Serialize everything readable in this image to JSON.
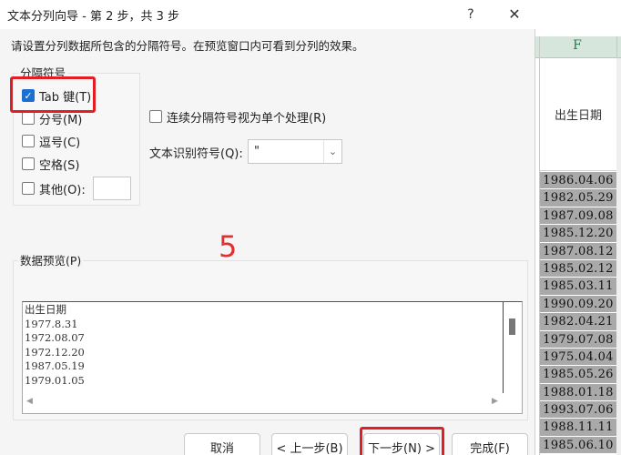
{
  "dialog": {
    "title": "文本分列向导 - 第 2 步，共 3 步",
    "help_label": "?",
    "close_label": "✕",
    "intro": "请设置分列数据所包含的分隔符号。在预览窗口内可看到分列的效果。"
  },
  "delimiters": {
    "group_label": "分隔符号",
    "items": [
      {
        "label": "Tab 键(T)",
        "checked": true
      },
      {
        "label": "分号(M)",
        "checked": false
      },
      {
        "label": "逗号(C)",
        "checked": false
      },
      {
        "label": "空格(S)",
        "checked": false
      },
      {
        "label": "其他(O):",
        "checked": false
      }
    ],
    "other_value": ""
  },
  "options": {
    "consecutive_label": "连续分隔符号视为单个处理(R)",
    "consecutive_checked": false,
    "qualifier_label": "文本识别符号(Q):",
    "qualifier_value": "\""
  },
  "annotation": {
    "step_number": "5",
    "color": "#e21d24"
  },
  "preview": {
    "label": "数据预览(P)",
    "lines": [
      "出生日期",
      "1977.8.31",
      "1972.08.07",
      "1972.12.20",
      "1987.05.19",
      "1979.01.05"
    ]
  },
  "buttons": {
    "cancel": "取消",
    "back": "< 上一步(B)",
    "next": "下一步(N) >",
    "finish": "完成(F)"
  },
  "spreadsheet": {
    "column_letter": "F",
    "header": "出生日期",
    "cells": [
      "1986.04.06",
      "1982.05.29",
      "1987.09.08",
      "1985.12.20",
      "1987.08.12",
      "1985.02.12",
      "1985.03.11",
      "1990.09.20",
      "1982.04.21",
      "1979.07.08",
      "1975.04.04",
      "1985.05.26",
      "1988.01.18",
      "1993.07.06",
      "1988.11.11",
      "1985.06.10"
    ]
  },
  "colors": {
    "checkbox_accent": "#1b6fd1",
    "column_header_bg": "#d7e6dd",
    "selected_cell_bg": "#a9a9a9"
  }
}
